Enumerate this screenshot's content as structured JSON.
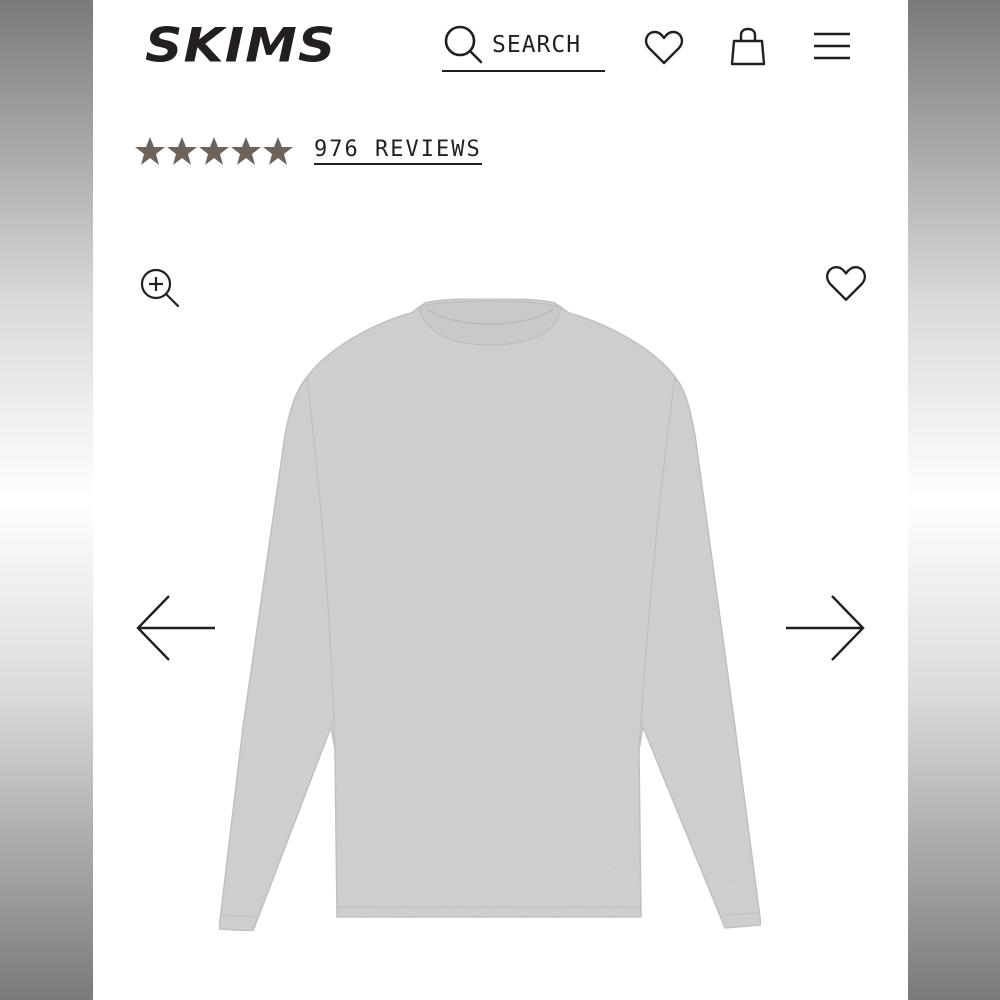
{
  "header": {
    "logo": "SKIMS",
    "search_label": "SEARCH"
  },
  "rating": {
    "stars": 5,
    "reviews_label": "976 REVIEWS",
    "star_color": "#6f6258"
  },
  "gallery": {
    "product_image": "gray-long-sleeve-tee",
    "icons": [
      "zoom-in-icon",
      "heart-icon",
      "arrow-left-icon",
      "arrow-right-icon"
    ]
  },
  "colors": {
    "ink": "#231f20",
    "shirt": "#d4d4d4"
  }
}
